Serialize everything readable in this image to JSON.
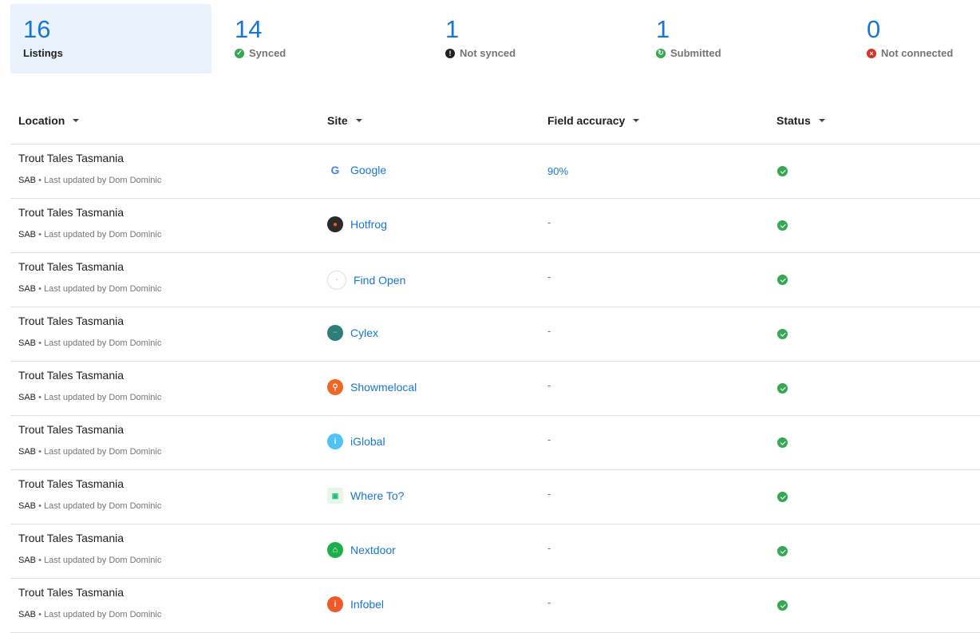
{
  "summary": {
    "listings": {
      "value": "16",
      "label": "Listings"
    },
    "synced": {
      "value": "14",
      "label": "Synced",
      "color": "#34a853"
    },
    "not_synced": {
      "value": "1",
      "label": "Not synced",
      "color": "#212121"
    },
    "submitted": {
      "value": "1",
      "label": "Submitted",
      "color": "#34a853"
    },
    "not_connected": {
      "value": "0",
      "label": "Not connected",
      "color": "#d93025"
    }
  },
  "table": {
    "headers": {
      "location": "Location",
      "site": "Site",
      "accuracy": "Field accuracy",
      "status": "Status"
    },
    "rows": [
      {
        "location": "Trout Tales Tasmania",
        "type": "SAB",
        "meta": "Last updated by Dom Dominic",
        "site": "Google",
        "icon": "google-logo",
        "accuracy": "90%",
        "status": "synced"
      },
      {
        "location": "Trout Tales Tasmania",
        "type": "SAB",
        "meta": "Last updated by Dom Dominic",
        "site": "Hotfrog",
        "icon": "hotfrog-logo",
        "accuracy": "-",
        "status": "synced"
      },
      {
        "location": "Trout Tales Tasmania",
        "type": "SAB",
        "meta": "Last updated by Dom Dominic",
        "site": "Find Open",
        "icon": "findopen-logo",
        "accuracy": "-",
        "status": "synced"
      },
      {
        "location": "Trout Tales Tasmania",
        "type": "SAB",
        "meta": "Last updated by Dom Dominic",
        "site": "Cylex",
        "icon": "cylex-logo",
        "accuracy": "-",
        "status": "synced"
      },
      {
        "location": "Trout Tales Tasmania",
        "type": "SAB",
        "meta": "Last updated by Dom Dominic",
        "site": "Showmelocal",
        "icon": "showmelocal-logo",
        "accuracy": "-",
        "status": "synced"
      },
      {
        "location": "Trout Tales Tasmania",
        "type": "SAB",
        "meta": "Last updated by Dom Dominic",
        "site": "iGlobal",
        "icon": "iglobal-logo",
        "accuracy": "-",
        "status": "synced"
      },
      {
        "location": "Trout Tales Tasmania",
        "type": "SAB",
        "meta": "Last updated by Dom Dominic",
        "site": "Where To?",
        "icon": "whereto-logo",
        "accuracy": "-",
        "status": "synced"
      },
      {
        "location": "Trout Tales Tasmania",
        "type": "SAB",
        "meta": "Last updated by Dom Dominic",
        "site": "Nextdoor",
        "icon": "nextdoor-logo",
        "accuracy": "-",
        "status": "synced"
      },
      {
        "location": "Trout Tales Tasmania",
        "type": "SAB",
        "meta": "Last updated by Dom Dominic",
        "site": "Infobel",
        "icon": "infobel-logo",
        "accuracy": "-",
        "status": "synced"
      }
    ]
  }
}
